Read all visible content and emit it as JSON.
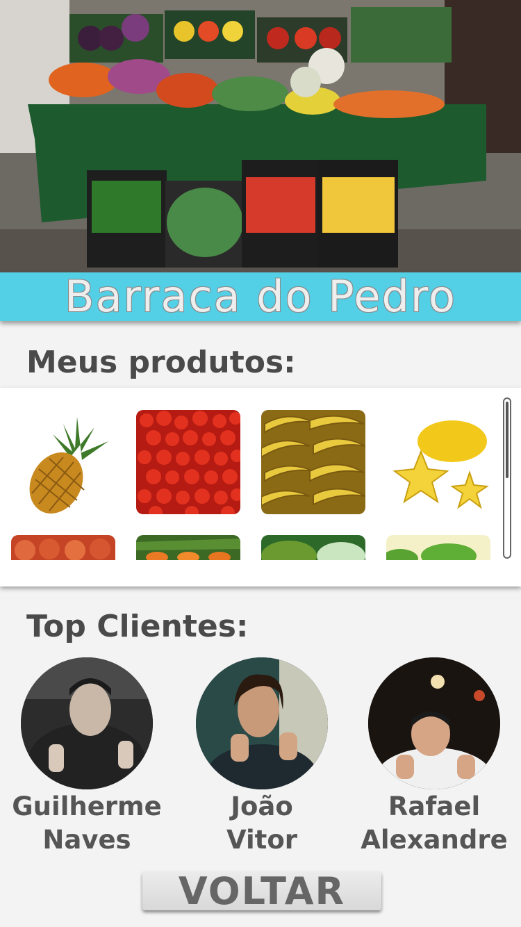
{
  "banner": {
    "title": "Barraca do Pedro"
  },
  "products": {
    "heading": "Meus produtos:",
    "items": [
      {
        "icon": "pineapple"
      },
      {
        "icon": "acerola"
      },
      {
        "icon": "banana"
      },
      {
        "icon": "starfruit"
      },
      {
        "icon": "tomato"
      },
      {
        "icon": "carrot"
      },
      {
        "icon": "soursop"
      },
      {
        "icon": "lime"
      }
    ]
  },
  "clients": {
    "heading": "Top Clientes:",
    "list": [
      {
        "first": "Guilherme",
        "last": "Naves"
      },
      {
        "first": "João",
        "last": "Vitor"
      },
      {
        "first": "Rafael",
        "last": "Alexandre"
      }
    ]
  },
  "back_button": {
    "label": "VOLTAR"
  },
  "colors": {
    "banner": "#53cfe6",
    "heading": "#4a4a4a",
    "background": "#f3f3f3"
  }
}
